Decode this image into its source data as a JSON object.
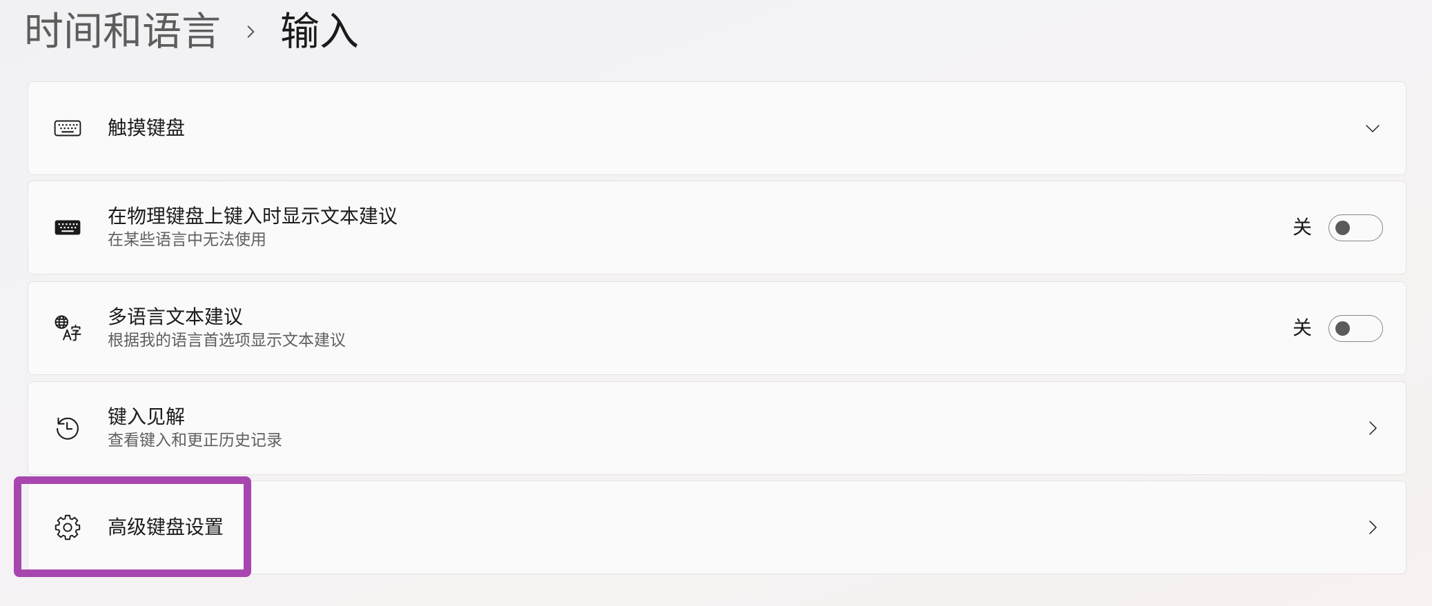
{
  "breadcrumb": {
    "parent": "时间和语言",
    "separator_icon": "chevron-right-icon",
    "current": "输入"
  },
  "settings": [
    {
      "icon": "touch-keyboard-icon",
      "title": "触摸键盘",
      "subtitle": "",
      "control": "expand",
      "control_icon": "chevron-down-icon"
    },
    {
      "icon": "keyboard-icon",
      "title": "在物理键盘上键入时显示文本建议",
      "subtitle": "在某些语言中无法使用",
      "control": "toggle",
      "state_label": "关",
      "on": false
    },
    {
      "icon": "language-icon",
      "title": "多语言文本建议",
      "subtitle": "根据我的语言首选项显示文本建议",
      "control": "toggle",
      "state_label": "关",
      "on": false
    },
    {
      "icon": "history-icon",
      "title": "键入见解",
      "subtitle": "查看键入和更正历史记录",
      "control": "navigate",
      "control_icon": "chevron-right-icon"
    },
    {
      "icon": "gear-icon",
      "title": "高级键盘设置",
      "subtitle": "",
      "control": "navigate",
      "control_icon": "chevron-right-icon"
    }
  ],
  "highlight": {
    "target": "高级键盘设置",
    "color": "#a846b0"
  },
  "colors": {
    "accent": "#005fb8",
    "text_primary": "#1b1b1b",
    "text_secondary": "#5f5f5f"
  }
}
